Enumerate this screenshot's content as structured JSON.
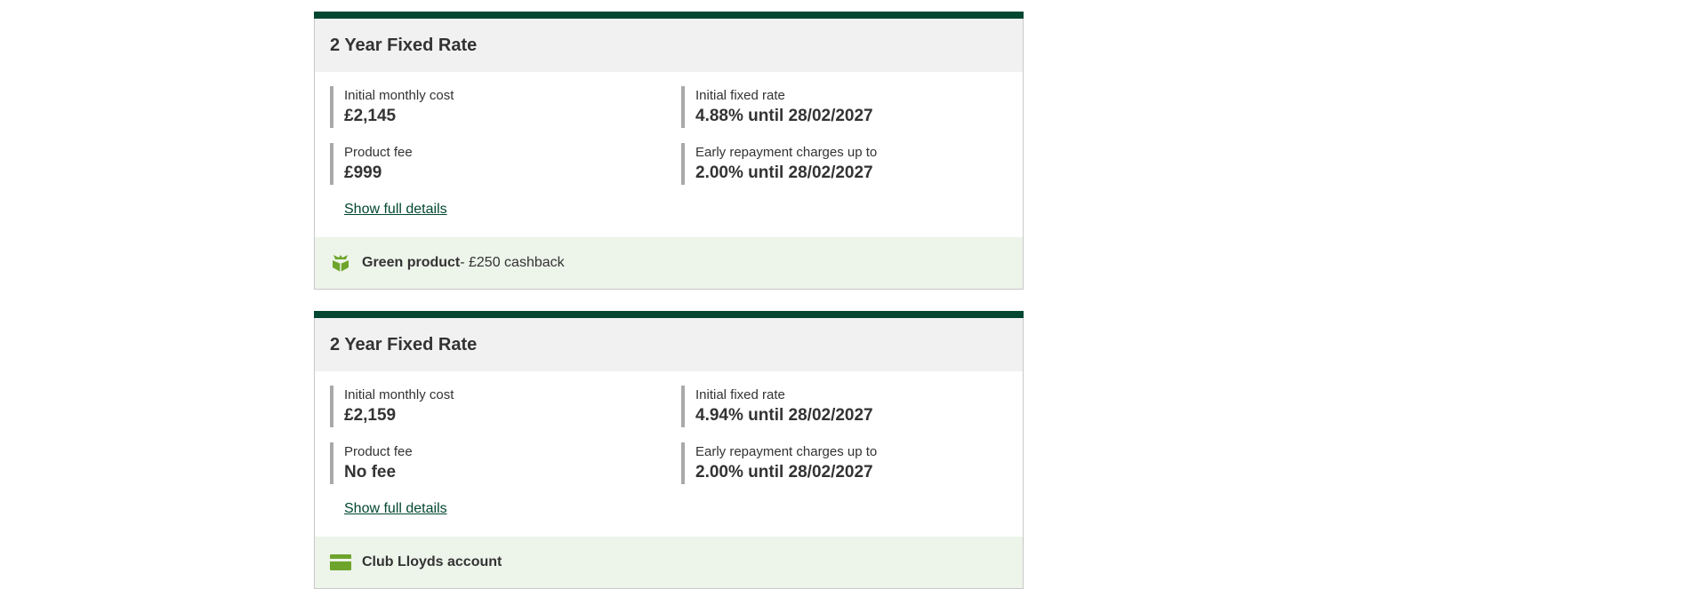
{
  "colors": {
    "brand_green": "#024731",
    "header_bg": "#f1f1f1",
    "footer_bg": "#edf4ea",
    "icon_green": "#6da52c",
    "stat_border": "#a9a9a9"
  },
  "products": [
    {
      "title": "2 Year Fixed Rate",
      "initial_monthly_cost_label": "Initial monthly cost",
      "initial_monthly_cost": "£2,145",
      "initial_fixed_rate_label": "Initial fixed rate",
      "initial_fixed_rate": "4.88% until 28/02/2027",
      "product_fee_label": "Product fee",
      "product_fee": "£999",
      "erc_label": "Early repayment charges up to",
      "erc": "2.00% until 28/02/2027",
      "details_link": "Show full details",
      "footer_icon": "leaf-gift-icon",
      "footer_strong": "Green product",
      "footer_rest": " - £250 cashback"
    },
    {
      "title": "2 Year Fixed Rate",
      "initial_monthly_cost_label": "Initial monthly cost",
      "initial_monthly_cost": "£2,159",
      "initial_fixed_rate_label": "Initial fixed rate",
      "initial_fixed_rate": "4.94% until 28/02/2027",
      "product_fee_label": "Product fee",
      "product_fee": "No fee",
      "erc_label": "Early repayment charges up to",
      "erc": "2.00% until 28/02/2027",
      "details_link": "Show full details",
      "footer_icon": "card-icon",
      "footer_strong": "Club Lloyds account",
      "footer_rest": ""
    }
  ]
}
